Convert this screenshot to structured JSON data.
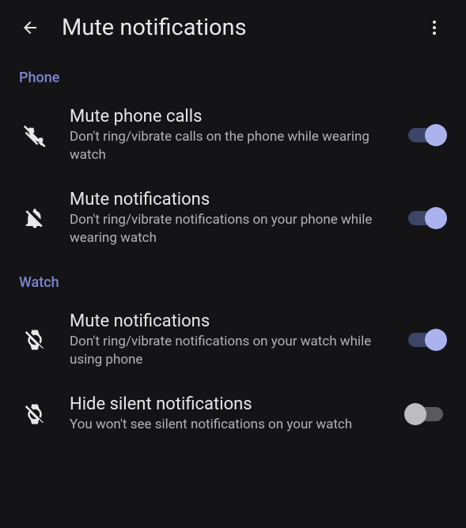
{
  "header": {
    "title": "Mute notifications"
  },
  "sections": {
    "phone": {
      "label": "Phone",
      "items": [
        {
          "title": "Mute phone calls",
          "desc": "Don't ring/vibrate calls on the phone while wearing watch",
          "checked": true
        },
        {
          "title": "Mute notifications",
          "desc": "Don't ring/vibrate notifications on your phone while wearing watch",
          "checked": true
        }
      ]
    },
    "watch": {
      "label": "Watch",
      "items": [
        {
          "title": "Mute notifications",
          "desc": "Don't ring/vibrate notifications on your watch while using phone",
          "checked": true
        },
        {
          "title": "Hide silent notifications",
          "desc": "You won't see silent notifications on your watch",
          "checked": false
        }
      ]
    }
  }
}
